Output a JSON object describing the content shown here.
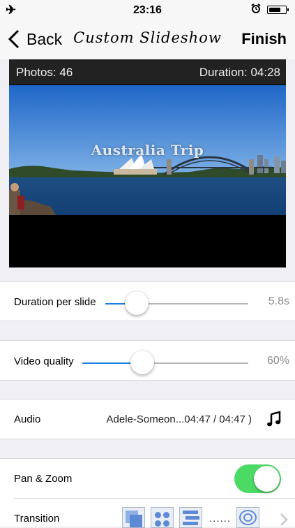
{
  "status": {
    "time": "23:16"
  },
  "nav": {
    "back_label": "Back",
    "title": "Custom Slideshow",
    "finish_label": "Finish"
  },
  "preview": {
    "photos_text": "Photos: 46",
    "duration_text": "Duration: 04:28",
    "overlay_title": "Australia Trip"
  },
  "duration_per_slide": {
    "label": "Duration per slide",
    "value_text": "5.8s",
    "level": 0.22
  },
  "video_quality": {
    "label": "Video quality",
    "value_text": "60%",
    "level": 0.36
  },
  "audio": {
    "label": "Audio",
    "track_text": "Adele-Someon...04:47 / 04:47 )"
  },
  "pan_zoom": {
    "label": "Pan & Zoom",
    "enabled": true
  },
  "transition": {
    "label": "Transition",
    "more_text": "......"
  },
  "colors": {
    "accent": "#1a7fe0",
    "toggle_on": "#4cd964",
    "background": "#efeff4"
  },
  "icons": [
    "airplane-icon",
    "alarm-icon",
    "battery-icon",
    "back-chevron-icon",
    "music-note-icon",
    "chevron-right-icon"
  ]
}
